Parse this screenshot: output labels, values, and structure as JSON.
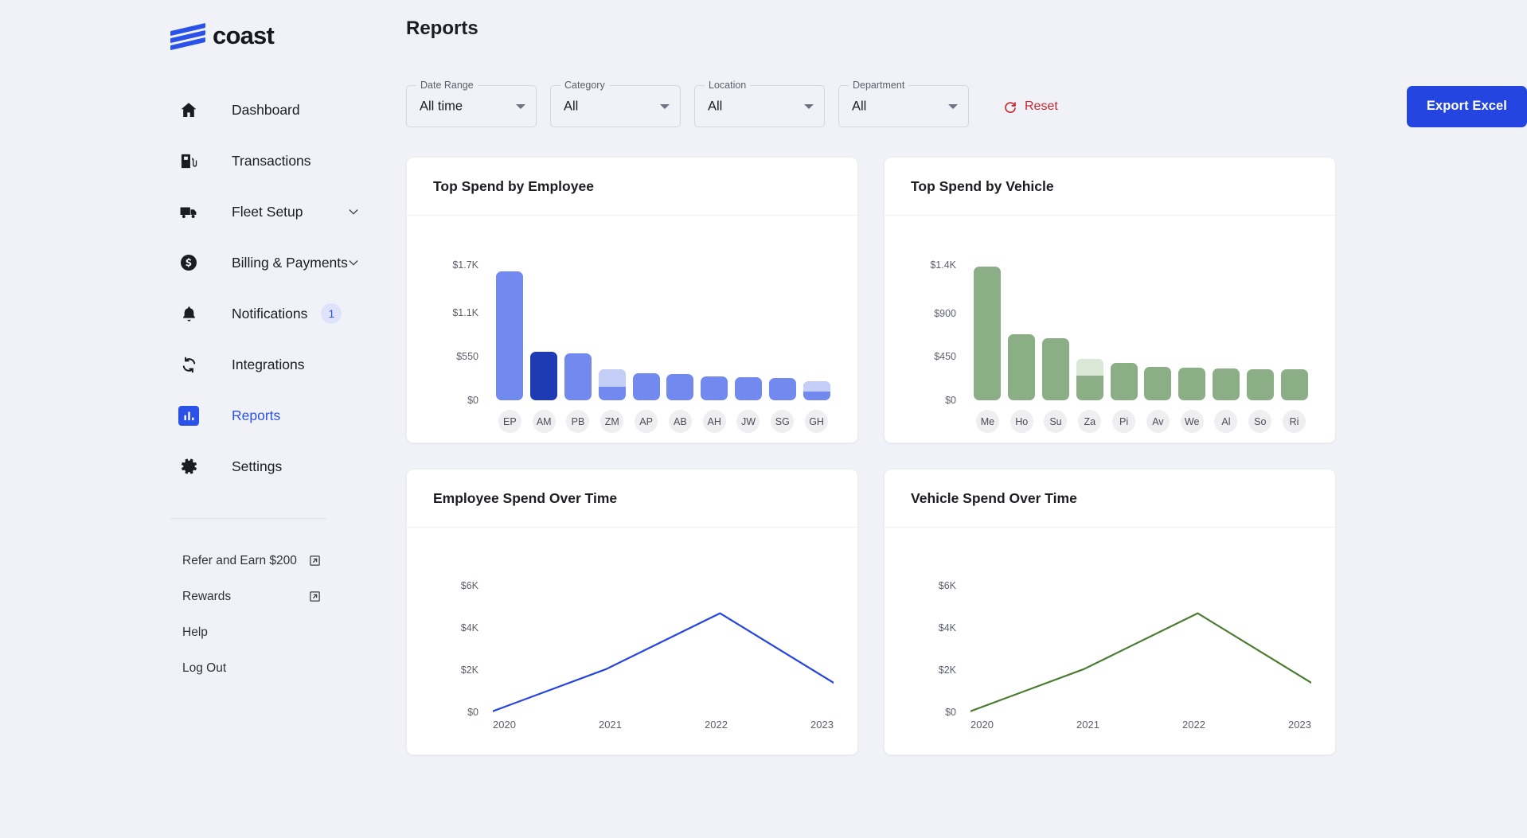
{
  "brand": {
    "name": "coast"
  },
  "sidebar": {
    "items": [
      {
        "label": "Dashboard",
        "icon": "home-icon",
        "active": false,
        "expandable": false
      },
      {
        "label": "Transactions",
        "icon": "fuel-pump-icon",
        "active": false,
        "expandable": false
      },
      {
        "label": "Fleet Setup",
        "icon": "truck-icon",
        "active": false,
        "expandable": true
      },
      {
        "label": "Billing & Payments",
        "icon": "dollar-circle-icon",
        "active": false,
        "expandable": true
      },
      {
        "label": "Notifications",
        "icon": "bell-icon",
        "active": false,
        "expandable": false,
        "badge": "1"
      },
      {
        "label": "Integrations",
        "icon": "sync-icon",
        "active": false,
        "expandable": false
      },
      {
        "label": "Reports",
        "icon": "bar-chart-icon",
        "active": true,
        "expandable": false
      },
      {
        "label": "Settings",
        "icon": "gear-icon",
        "active": false,
        "expandable": false
      }
    ],
    "footer_links": [
      {
        "label": "Refer and Earn $200",
        "external": true
      },
      {
        "label": "Rewards",
        "external": true
      },
      {
        "label": "Help",
        "external": false
      },
      {
        "label": "Log Out",
        "external": false
      }
    ]
  },
  "header": {
    "title": "Reports"
  },
  "filters": {
    "fields": [
      {
        "label": "Date Range",
        "value": "All time"
      },
      {
        "label": "Category",
        "value": "All"
      },
      {
        "label": "Location",
        "value": "All"
      },
      {
        "label": "Department",
        "value": "All"
      }
    ],
    "reset_label": "Reset",
    "export_label": "Export Excel"
  },
  "colors": {
    "brand_blue": "#2A52E8",
    "export_blue": "#2545E0",
    "reset_red": "#C4292F",
    "bar_blue": "#7289F0",
    "bar_blue_dark": "#1E3BB3",
    "bar_blue_light": "#C5CEF7",
    "bar_green": "#8CAE86",
    "bar_green_light": "#DBE7D7",
    "line_blue": "#2545E0",
    "line_green": "#4A7C32",
    "badge_bg": "#DEE3FB"
  },
  "chart_data": [
    {
      "id": "top-spend-by-employee",
      "type": "bar",
      "title": "Top Spend by Employee",
      "categories": [
        "EP",
        "AM",
        "PB",
        "ZM",
        "AP",
        "AB",
        "AH",
        "JW",
        "SG",
        "GH"
      ],
      "values": [
        1620,
        610,
        590,
        390,
        340,
        330,
        300,
        290,
        280,
        240
      ],
      "stacked_top": [
        0,
        0,
        0,
        215,
        0,
        0,
        0,
        0,
        0,
        130
      ],
      "colors": [
        "#7289F0",
        "#1E3BB3",
        "#7289F0",
        "#7289F0",
        "#7289F0",
        "#7289F0",
        "#7289F0",
        "#7289F0",
        "#7289F0",
        "#7289F0"
      ],
      "stack_color": "#C5CEF7",
      "ylabel": "",
      "xlabel": "",
      "yticks": [
        "$0",
        "$550",
        "$1.1K",
        "$1.7K"
      ],
      "ytick_values": [
        0,
        550,
        1100,
        1700
      ],
      "ylim": [
        0,
        1700
      ],
      "grid": false,
      "legend": "none"
    },
    {
      "id": "top-spend-by-vehicle",
      "type": "bar",
      "title": "Top Spend by Vehicle",
      "categories": [
        "Me",
        "Ho",
        "Su",
        "Za",
        "Pi",
        "Av",
        "We",
        "Al",
        "So",
        "Ri"
      ],
      "values": [
        1380,
        680,
        640,
        430,
        390,
        350,
        340,
        330,
        320,
        320
      ],
      "stacked_top": [
        0,
        0,
        0,
        175,
        0,
        0,
        0,
        0,
        0,
        0
      ],
      "colors": [
        "#8CAE86",
        "#8CAE86",
        "#8CAE86",
        "#8CAE86",
        "#8CAE86",
        "#8CAE86",
        "#8CAE86",
        "#8CAE86",
        "#8CAE86",
        "#8CAE86"
      ],
      "stack_color": "#DBE7D7",
      "ylabel": "",
      "xlabel": "",
      "yticks": [
        "$0",
        "$450",
        "$900",
        "$1.4K"
      ],
      "ytick_values": [
        0,
        450,
        900,
        1400
      ],
      "ylim": [
        0,
        1400
      ],
      "grid": false,
      "legend": "none"
    },
    {
      "id": "employee-spend-over-time",
      "type": "line",
      "title": "Employee Spend Over Time",
      "x": [
        "2020",
        "2021",
        "2022",
        "2023"
      ],
      "values": [
        50,
        2050,
        4700,
        1400
      ],
      "color": "#2545E0",
      "ylabel": "",
      "xlabel": "",
      "yticks": [
        "$0",
        "$2K",
        "$4K",
        "$6K"
      ],
      "ytick_values": [
        0,
        2000,
        4000,
        6000
      ],
      "ylim": [
        0,
        6800
      ],
      "grid": false,
      "legend": "none"
    },
    {
      "id": "vehicle-spend-over-time",
      "type": "line",
      "title": "Vehicle Spend Over Time",
      "x": [
        "2020",
        "2021",
        "2022",
        "2023"
      ],
      "values": [
        50,
        2050,
        4700,
        1400
      ],
      "color": "#4A7C32",
      "ylabel": "",
      "xlabel": "",
      "yticks": [
        "$0",
        "$2K",
        "$4K",
        "$6K"
      ],
      "ytick_values": [
        0,
        2000,
        4000,
        6000
      ],
      "ylim": [
        0,
        6800
      ],
      "grid": false,
      "legend": "none"
    }
  ]
}
